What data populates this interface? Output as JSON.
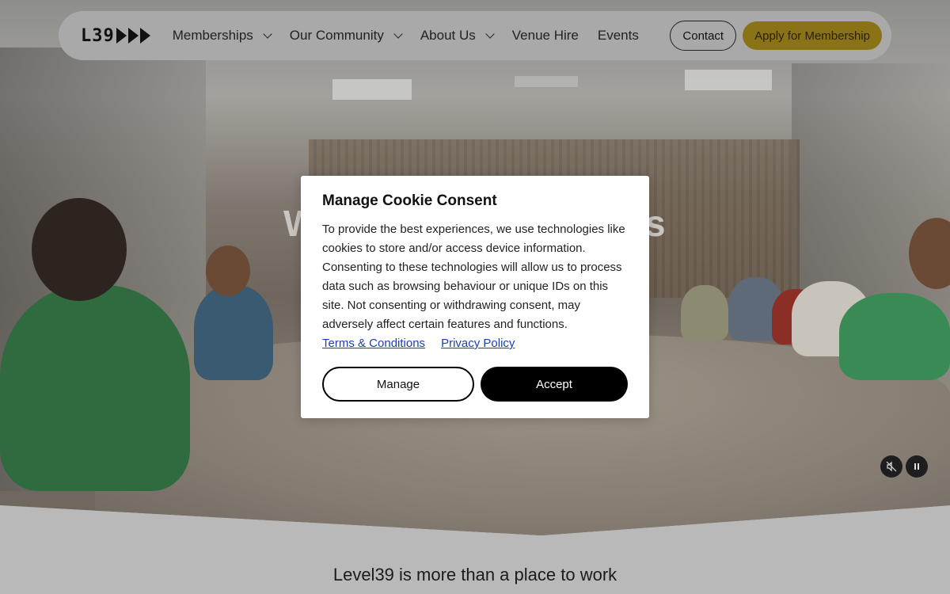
{
  "nav": {
    "logo_text": "L39",
    "items": [
      {
        "label": "Memberships",
        "has_dropdown": true
      },
      {
        "label": "Our Community",
        "has_dropdown": true
      },
      {
        "label": "About Us",
        "has_dropdown": true
      },
      {
        "label": "Venue Hire",
        "has_dropdown": false
      },
      {
        "label": "Events",
        "has_dropdown": false
      }
    ],
    "contact_label": "Contact",
    "apply_label": "Apply for Membership"
  },
  "hero": {
    "video_controls": {
      "mute_icon": "mute-icon",
      "pause_icon": "pause-icon"
    }
  },
  "cookie_modal": {
    "title": "Manage Cookie Consent",
    "body": "To provide the best experiences, we use technologies like cookies to store and/or access device information. Consenting to these technologies will allow us to process data such as browsing behaviour or unique IDs on this site. Not consenting or withdrawing consent, may adversely affect certain features and functions.",
    "terms_link": "Terms & Conditions",
    "privacy_link": "Privacy Policy",
    "manage_label": "Manage",
    "accept_label": "Accept"
  },
  "section": {
    "tagline": "Level39 is more than a place to work"
  },
  "colors": {
    "apply_button": "#8a7217",
    "link": "#1a3fb4",
    "accept_button": "#000000"
  }
}
